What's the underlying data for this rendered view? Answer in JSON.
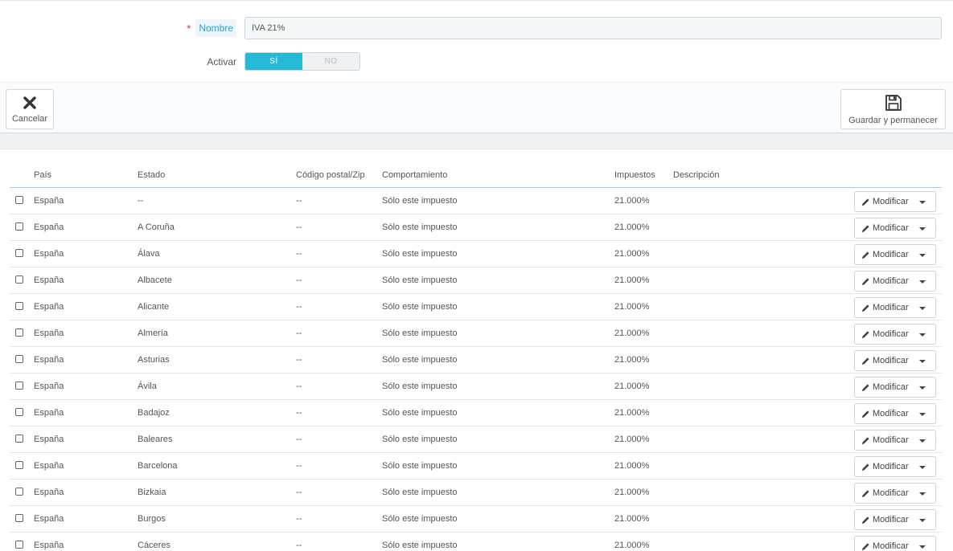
{
  "form": {
    "name_label": "Nombre",
    "required_mark": "*",
    "name_value": "IVA 21%",
    "active_label": "Activar",
    "switch_yes": "SÍ",
    "switch_no": "NO"
  },
  "toolbar": {
    "cancel_label": "Cancelar",
    "save_label": "Guardar y permanecer"
  },
  "table": {
    "headers": {
      "pais": "País",
      "estado": "Estado",
      "zip": "Código postal/Zip",
      "comportamiento": "Comportamiento",
      "impuestos": "Impuestos",
      "descripcion": "Descripción"
    },
    "action_label": "Modificar",
    "rows": [
      {
        "pais": "España",
        "estado": "--",
        "zip": "--",
        "comportamiento": "Sólo este impuesto",
        "impuestos": "21.000%",
        "descripcion": ""
      },
      {
        "pais": "España",
        "estado": "A Coruña",
        "zip": "--",
        "comportamiento": "Sólo este impuesto",
        "impuestos": "21.000%",
        "descripcion": ""
      },
      {
        "pais": "España",
        "estado": "Álava",
        "zip": "--",
        "comportamiento": "Sólo este impuesto",
        "impuestos": "21.000%",
        "descripcion": ""
      },
      {
        "pais": "España",
        "estado": "Albacete",
        "zip": "--",
        "comportamiento": "Sólo este impuesto",
        "impuestos": "21.000%",
        "descripcion": ""
      },
      {
        "pais": "España",
        "estado": "Alicante",
        "zip": "--",
        "comportamiento": "Sólo este impuesto",
        "impuestos": "21.000%",
        "descripcion": ""
      },
      {
        "pais": "España",
        "estado": "Almería",
        "zip": "--",
        "comportamiento": "Sólo este impuesto",
        "impuestos": "21.000%",
        "descripcion": ""
      },
      {
        "pais": "España",
        "estado": "Asturias",
        "zip": "--",
        "comportamiento": "Sólo este impuesto",
        "impuestos": "21.000%",
        "descripcion": ""
      },
      {
        "pais": "España",
        "estado": "Ávila",
        "zip": "--",
        "comportamiento": "Sólo este impuesto",
        "impuestos": "21.000%",
        "descripcion": ""
      },
      {
        "pais": "España",
        "estado": "Badajoz",
        "zip": "--",
        "comportamiento": "Sólo este impuesto",
        "impuestos": "21.000%",
        "descripcion": ""
      },
      {
        "pais": "España",
        "estado": "Baleares",
        "zip": "--",
        "comportamiento": "Sólo este impuesto",
        "impuestos": "21.000%",
        "descripcion": ""
      },
      {
        "pais": "España",
        "estado": "Barcelona",
        "zip": "--",
        "comportamiento": "Sólo este impuesto",
        "impuestos": "21.000%",
        "descripcion": ""
      },
      {
        "pais": "España",
        "estado": "Bizkaia",
        "zip": "--",
        "comportamiento": "Sólo este impuesto",
        "impuestos": "21.000%",
        "descripcion": ""
      },
      {
        "pais": "España",
        "estado": "Burgos",
        "zip": "--",
        "comportamiento": "Sólo este impuesto",
        "impuestos": "21.000%",
        "descripcion": ""
      },
      {
        "pais": "España",
        "estado": "Cáceres",
        "zip": "--",
        "comportamiento": "Sólo este impuesto",
        "impuestos": "21.000%",
        "descripcion": ""
      }
    ]
  },
  "icons": {
    "cancel": "close-icon",
    "save": "floppy-disk-icon",
    "edit": "pencil-icon",
    "dropdown": "caret-down-icon"
  },
  "colors": {
    "accent": "#25b9d7",
    "required": "#e0302e",
    "label_link": "#25a0c9"
  }
}
